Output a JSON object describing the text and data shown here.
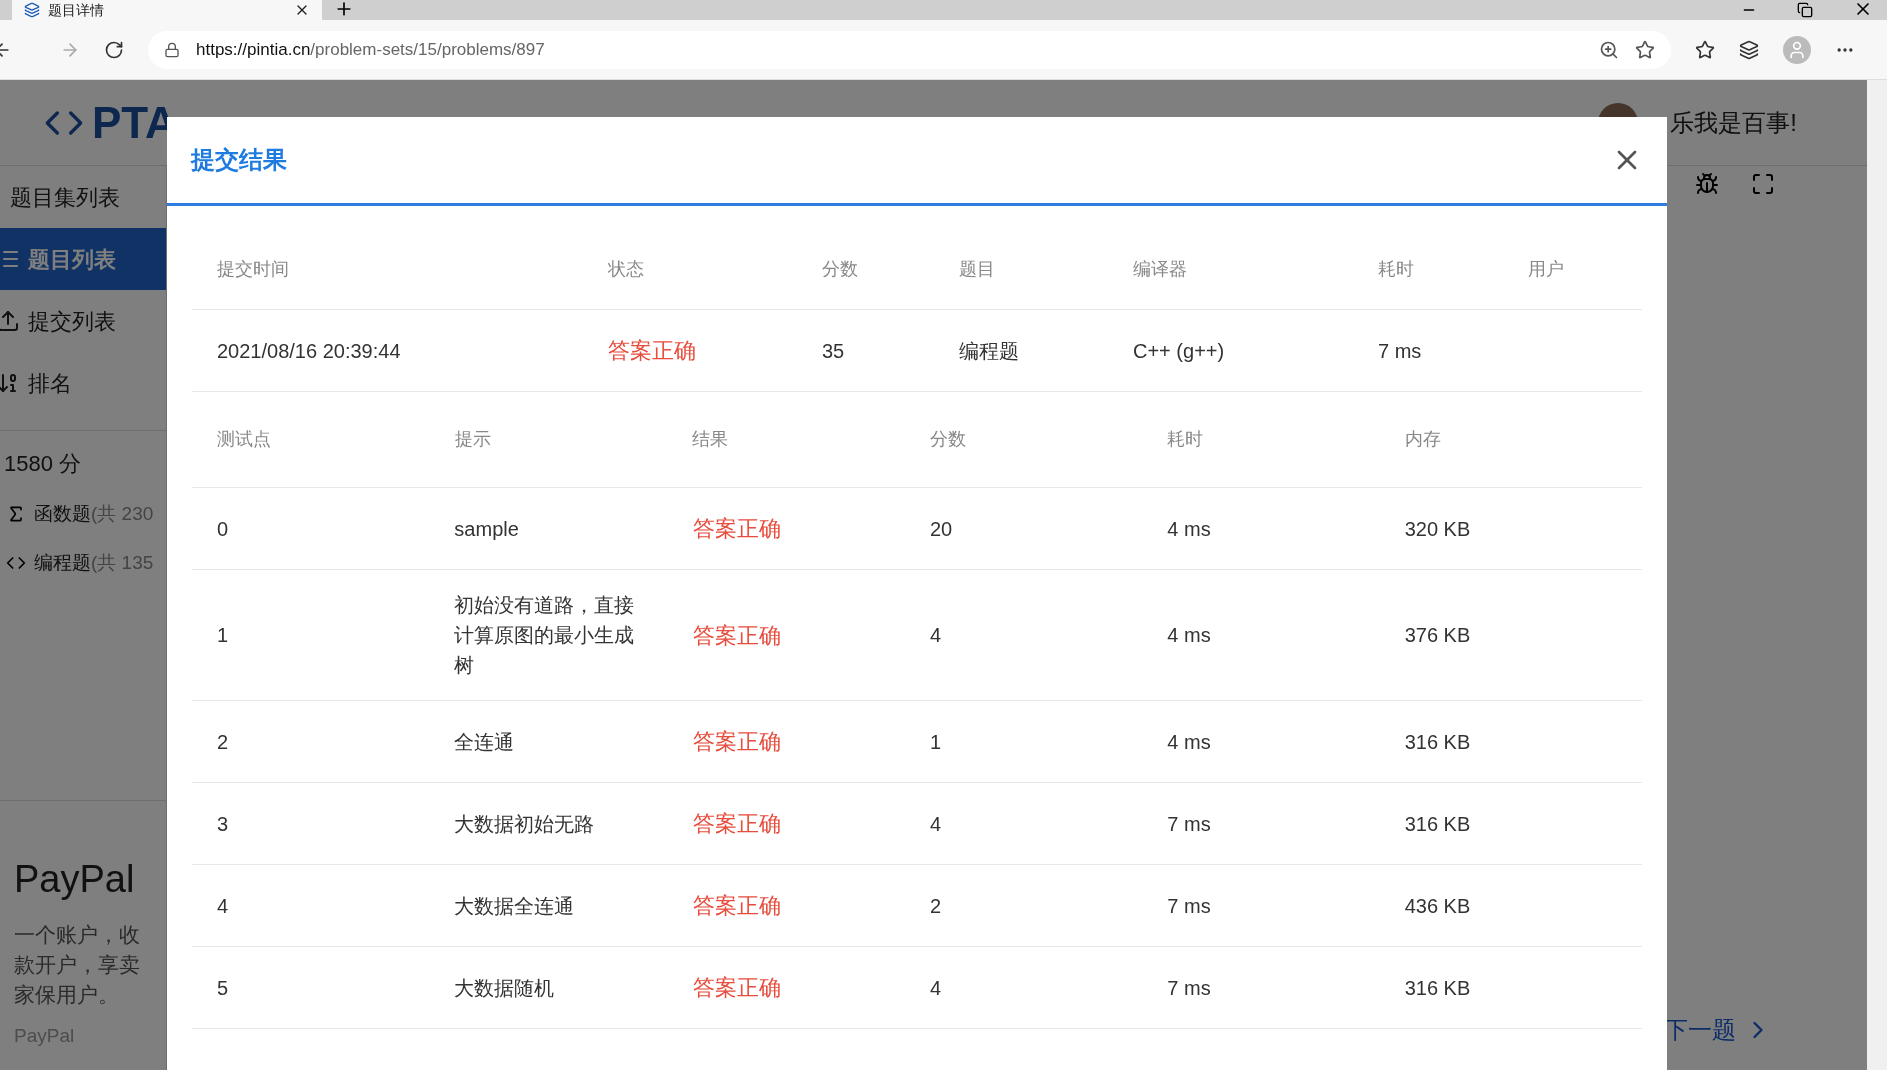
{
  "browser": {
    "tab_title": "题目详情",
    "url_host": "https://pintia.cn",
    "url_path": "/problem-sets/15/problems/897"
  },
  "header": {
    "logo": "PTA",
    "user": "乐我是百事!"
  },
  "sidebar": {
    "items": [
      {
        "label": "题目集列表",
        "selected": false,
        "kind": "plain"
      },
      {
        "label": "题目列表",
        "selected": true,
        "kind": "list"
      },
      {
        "label": "提交列表",
        "selected": false,
        "kind": "upload"
      },
      {
        "label": "排名",
        "selected": false,
        "kind": "rank"
      }
    ],
    "total": "1580 分",
    "categories": [
      {
        "label": "函数题",
        "count": "(共 230",
        "kind": "function"
      },
      {
        "label": "编程题",
        "count": "(共 135",
        "kind": "code"
      }
    ],
    "ad": {
      "title": "PayPal",
      "text": "一个账户，收款开户，享卖家保用户。",
      "source": "PayPal"
    }
  },
  "next_link": "下一题",
  "modal": {
    "title": "提交结果",
    "summary": {
      "columns": [
        "提交时间",
        "状态",
        "分数",
        "题目",
        "编译器",
        "耗时",
        "用户"
      ],
      "row": {
        "time": "2021/08/16 20:39:44",
        "status": "答案正确",
        "status_ok": true,
        "score": "35",
        "problem": "编程题",
        "compiler": "C++ (g++)",
        "duration": "7 ms"
      }
    },
    "cases": {
      "columns": [
        "测试点",
        "提示",
        "结果",
        "分数",
        "耗时",
        "内存"
      ],
      "rows": [
        {
          "id": "0",
          "hint": "sample",
          "result": "答案正确",
          "ok": true,
          "score": "20",
          "time": "4 ms",
          "memory": "320 KB"
        },
        {
          "id": "1",
          "hint": "初始没有道路，直接计算原图的最小生成树",
          "result": "答案正确",
          "ok": true,
          "score": "4",
          "time": "4 ms",
          "memory": "376 KB"
        },
        {
          "id": "2",
          "hint": "全连通",
          "result": "答案正确",
          "ok": true,
          "score": "1",
          "time": "4 ms",
          "memory": "316 KB"
        },
        {
          "id": "3",
          "hint": "大数据初始无路",
          "result": "答案正确",
          "ok": true,
          "score": "4",
          "time": "7 ms",
          "memory": "316 KB"
        },
        {
          "id": "4",
          "hint": "大数据全连通",
          "result": "答案正确",
          "ok": true,
          "score": "2",
          "time": "7 ms",
          "memory": "436 KB"
        },
        {
          "id": "5",
          "hint": "大数据随机",
          "result": "答案正确",
          "ok": true,
          "score": "4",
          "time": "7 ms",
          "memory": "316 KB"
        }
      ]
    }
  }
}
